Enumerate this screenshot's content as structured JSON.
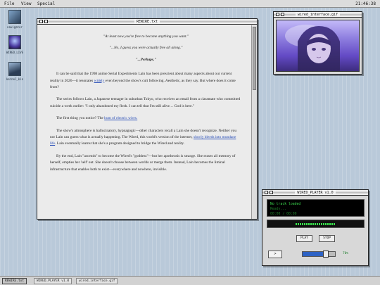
{
  "menubar": {
    "items": [
      {
        "label": "File"
      },
      {
        "label": "View"
      },
      {
        "label": "Special"
      }
    ],
    "clock": "21:46:38"
  },
  "desktop": {
    "icons": [
      {
        "label": "navigator"
      },
      {
        "label": "WIRED_LIVE"
      },
      {
        "label": "kernel_kin"
      }
    ]
  },
  "text_window": {
    "title": "REWIRE.txt",
    "quotes": [
      "\"At least now you're free to become anything you want.\"",
      "\"...No, I guess you were actually free all along.\"",
      "\"...Perhaps.\""
    ],
    "paragraphs": [
      {
        "pre": "It can be said that the 1998 anime Serial Experiments Lain has been prescient about many aspects about our current reality in 2026—it resonates ",
        "link": "widely",
        "post": " even beyond the show's cult following. Aesthetic, as they say. But where does it come from?"
      },
      {
        "pre": "The series follows Lain, a Japanese teenager in suburban Tokyo, who receives an email from a classmate who committed suicide a week earlier: \"I only abandoned my flesh. I can tell that I'm still alive… God is here.\"",
        "link": "",
        "post": ""
      },
      {
        "pre": "The first thing you notice? The ",
        "link": "hum of electric wires.",
        "post": ""
      },
      {
        "pre": "The show's atmosphere is hallucinatory, hypnagogic—other characters recall a Lain she doesn't recognize. Neither you nor Lain can guess what is actually happening. The Wired, this world's version of the internet, ",
        "link": "slowly bleeds into mundane life",
        "post": ". Lain eventually learns that she's a program designed to bridge the Wired and reality."
      },
      {
        "pre": "By the end, Lain \"ascends\" to become the Wired's \"goddess\"—but her apotheosis is strange. She erases all memory of herself, empties her 'self' out. She doesn't choose between worlds or merge them. Instead, Lain becomes the liminal infrastructure that enables both to exist—everywhere and nowhere, invisible.",
        "link": "",
        "post": ""
      }
    ]
  },
  "gif_window": {
    "title": "wired_interface.gif"
  },
  "player": {
    "title": "WIRED_PLAYER v1.0",
    "status": "No track loaded",
    "status_sub1": "Ready...",
    "status_sub2": "00:00 / 00:00",
    "play_label": "PLAY",
    "stop_label": "STOP",
    "skip_label": ">",
    "volume": 0.72,
    "volume_pct": "70%"
  },
  "taskbar": {
    "tasks": [
      {
        "label": "REWIRE.txt"
      },
      {
        "label": "WIRED_PLAYER v1.0"
      },
      {
        "label": "wired_interface.gif"
      }
    ]
  },
  "colors": {
    "accent_green": "#3bd74d",
    "link_blue": "#2a4fb8",
    "volume_blue": "#2d62c4"
  }
}
